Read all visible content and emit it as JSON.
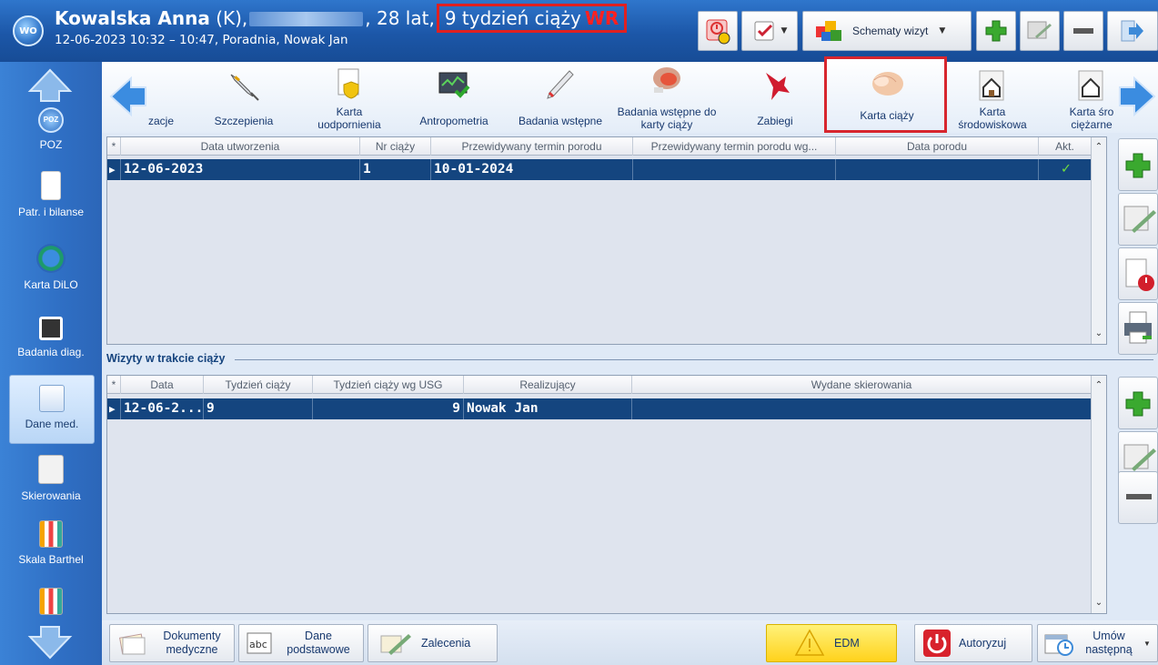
{
  "header": {
    "avatar": "WO",
    "patient_name": "Kowalska Anna",
    "patient_sex": " (K),",
    "age": ", 28 lat,",
    "pregnancy_week": "9 tydzień ciąży",
    "pregnancy_flag": "WR",
    "visit_info": "12-06-2023 10:32 – 10:47, Poradnia, Nowak Jan",
    "schemes_label": "Schematy wizyt"
  },
  "sidebar": {
    "items": [
      {
        "label": "POZ"
      },
      {
        "label": "Patr. i bilanse"
      },
      {
        "label": "Karta DiLO"
      },
      {
        "label": "Badania diag."
      },
      {
        "label": "Dane med."
      },
      {
        "label": "Skierowania"
      },
      {
        "label": "Skala Barthel"
      }
    ]
  },
  "toolbar": {
    "items": [
      {
        "label": "zacje"
      },
      {
        "label": "Szczepienia"
      },
      {
        "label": "Karta uodpornienia"
      },
      {
        "label": "Antropometria"
      },
      {
        "label": "Badania wstępne"
      },
      {
        "label": "Badania wstępne do karty ciąży"
      },
      {
        "label": "Zabiegi"
      },
      {
        "label": "Karta ciąży"
      },
      {
        "label": "Karta środowiskowa"
      },
      {
        "label": "Karta śro ciężarne"
      }
    ]
  },
  "pregnancies_table": {
    "headers": [
      "Data utworzenia",
      "Nr ciąży",
      "Przewidywany termin porodu",
      "Przewidywany termin porodu wg...",
      "Data porodu",
      "Akt."
    ],
    "rows": [
      {
        "date": "12-06-2023",
        "nr": "1",
        "due": "10-01-2024",
        "due_usg": "",
        "birth": "",
        "active": "✓"
      }
    ]
  },
  "visits_section": {
    "title": "Wizyty w trakcie ciąży",
    "headers": [
      "Data",
      "Tydzień ciąży",
      "Tydzień ciąży wg USG",
      "Realizujący",
      "Wydane skierowania"
    ],
    "rows": [
      {
        "date": "12-06-2...",
        "week": "9",
        "week_usg": "9",
        "doctor": "Nowak Jan",
        "referrals": ""
      }
    ]
  },
  "bottom": {
    "docs": "Dokumenty medyczne",
    "basic": "Dane podstawowe",
    "recommendations": "Zalecenia",
    "edm": "EDM",
    "authorize": "Autoryzuj",
    "schedule": "Umów następną"
  },
  "colors": {
    "accent": "#1c57a8",
    "selected_row": "#14457f",
    "highlight": "#d7262e"
  }
}
